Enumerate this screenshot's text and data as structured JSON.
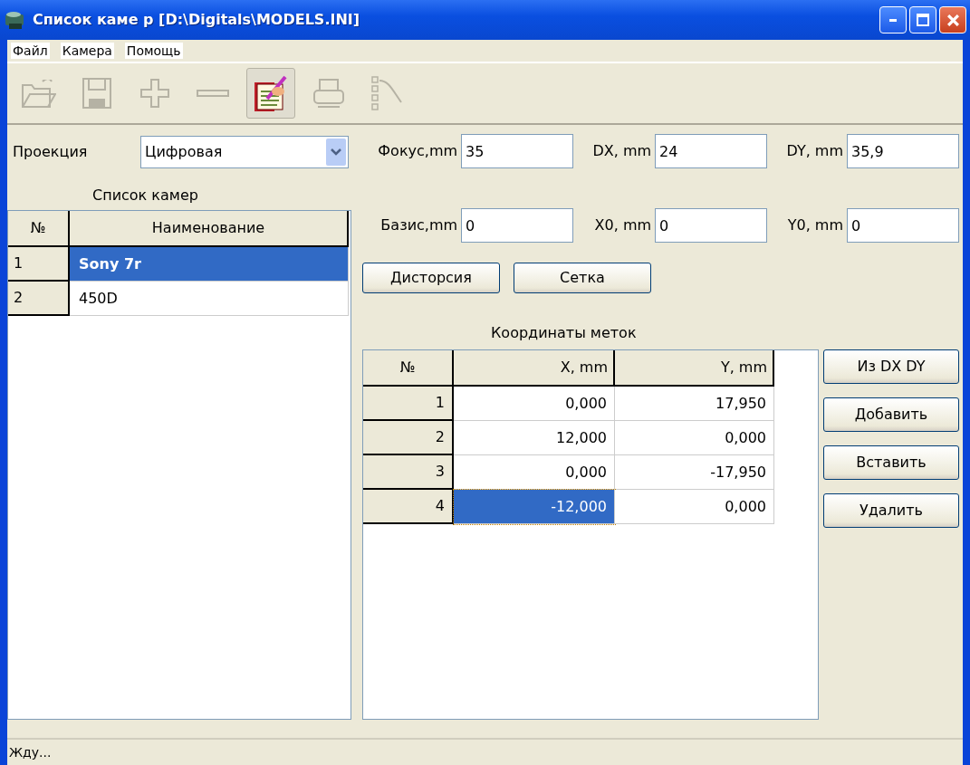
{
  "window": {
    "title": "Список каме р [D:\\Digitals\\MODELS.INI]"
  },
  "menu": [
    {
      "label": "Файл"
    },
    {
      "label": "Камера"
    },
    {
      "label": "Помощь"
    }
  ],
  "toolbar": [
    {
      "kind": "open",
      "disabled": true,
      "pressed": false
    },
    {
      "kind": "save",
      "disabled": true,
      "pressed": false
    },
    {
      "kind": "add",
      "disabled": true,
      "pressed": false
    },
    {
      "kind": "remove",
      "disabled": true,
      "pressed": false
    },
    {
      "kind": "edit",
      "disabled": false,
      "pressed": true
    },
    {
      "kind": "print",
      "disabled": true,
      "pressed": false
    },
    {
      "kind": "tree",
      "disabled": true,
      "pressed": false
    }
  ],
  "projection": {
    "label": "Проекция",
    "value": "Цифровая"
  },
  "fields": [
    {
      "label": "Фокус,mm",
      "value": "35"
    },
    {
      "label": "DX, mm",
      "value": "24"
    },
    {
      "label": "DY, mm",
      "value": "35,9"
    },
    {
      "label": "Базис,mm",
      "value": "0"
    },
    {
      "label": "X0, mm",
      "value": "0"
    },
    {
      "label": "Y0, mm",
      "value": "0"
    }
  ],
  "param_buttons": [
    "Дисторсия",
    "Сетка"
  ],
  "cameras": {
    "title": "Список камер",
    "columns": [
      "№",
      "Наименование"
    ],
    "rows": [
      {
        "num": "1",
        "name": "Sony 7r",
        "selected": true
      },
      {
        "num": "2",
        "name": "450D",
        "selected": false
      }
    ]
  },
  "marks": {
    "title": "Координаты меток",
    "columns": [
      "№",
      "X, mm",
      "Y, mm"
    ],
    "rows": [
      {
        "cells": [
          {
            "text": "1",
            "selected": false
          },
          {
            "text": "0,000",
            "selected": false
          },
          {
            "text": "17,950",
            "selected": false
          }
        ]
      },
      {
        "cells": [
          {
            "text": "2",
            "selected": false
          },
          {
            "text": "12,000",
            "selected": false
          },
          {
            "text": "0,000",
            "selected": false
          }
        ]
      },
      {
        "cells": [
          {
            "text": "3",
            "selected": false
          },
          {
            "text": "0,000",
            "selected": false
          },
          {
            "text": "-17,950",
            "selected": false
          }
        ]
      },
      {
        "cells": [
          {
            "text": "4",
            "selected": false
          },
          {
            "text": "-12,000",
            "selected": true
          },
          {
            "text": "0,000",
            "selected": false
          }
        ]
      }
    ]
  },
  "mark_buttons": [
    "Из DX DY",
    "Добавить",
    "Вставить",
    "Удалить"
  ],
  "status_bar": "Жду..."
}
